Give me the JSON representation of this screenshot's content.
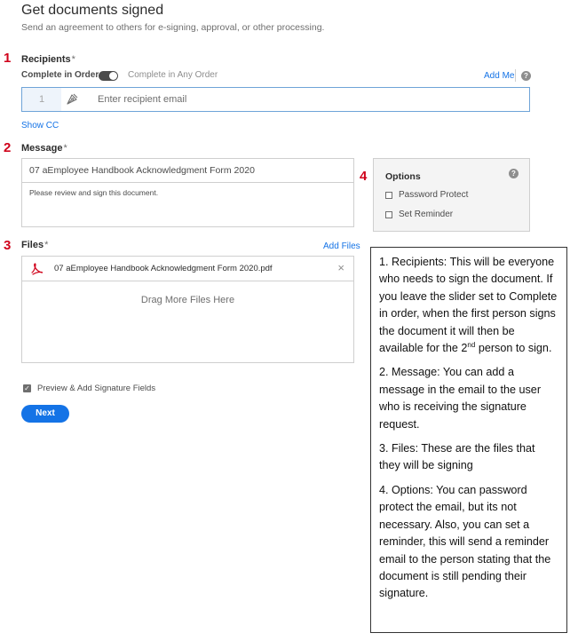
{
  "header": {
    "title": "Get documents signed",
    "subtitle": "Send an agreement to others for e-signing, approval, or other processing."
  },
  "steps": {
    "one": "1",
    "two": "2",
    "three": "3",
    "four": "4"
  },
  "recipients": {
    "label": "Recipients",
    "required_mark": "*",
    "complete_in_order": "Complete in Order",
    "complete_any_order": "Complete in Any Order",
    "toggle_state": "order",
    "add_me": "Add Me",
    "help_glyph": "?",
    "index": "1",
    "email_placeholder": "Enter recipient email",
    "email_value": "",
    "show_cc": "Show CC"
  },
  "message": {
    "label": "Message",
    "required_mark": "*",
    "subject": "07 aEmployee Handbook Acknowledgment Form 2020",
    "body": "Please review and sign this document."
  },
  "options": {
    "title": "Options",
    "help_glyph": "?",
    "password_protect": "Password Protect",
    "set_reminder": "Set Reminder"
  },
  "files": {
    "label": "Files",
    "required_mark": "*",
    "add_files": "Add Files",
    "items": [
      {
        "name": "07 aEmployee Handbook Acknowledgment Form 2020.pdf",
        "remove_glyph": "×"
      }
    ],
    "drag_text": "Drag More Files Here"
  },
  "preview": {
    "label": "Preview & Add Signature Fields",
    "checked": true,
    "check_glyph": "✓"
  },
  "next_button": "Next",
  "callout": {
    "p1_main": "1. Recipients: This will be everyone who needs to sign the document. If you leave the slider set to Complete in order, when the first person signs the document it will then be available for the 2",
    "p1_sup": "nd",
    "p1_end": " person to sign.",
    "p2": "2. Message: You can add a message in the email to the user who is receiving the signature request.",
    "p3": "3. Files: These are the files that they will be signing",
    "p4": "4. Options: You can password protect the email, but its not necessary. Also, you can set a reminder, this will send a reminder email to the person stating that the document is still pending their signature."
  },
  "colors": {
    "accent": "#1473e6",
    "step_number": "#d0021b",
    "recipient_border": "#6fa4d8",
    "pdf_red": "#d0021b"
  }
}
